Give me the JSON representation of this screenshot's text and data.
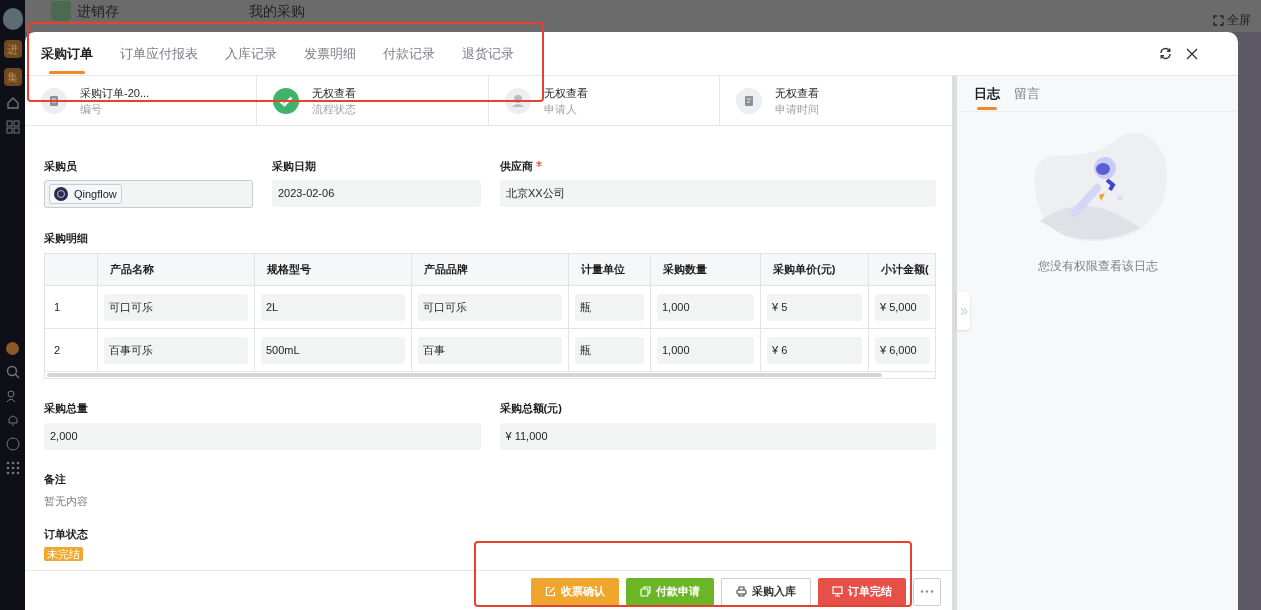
{
  "background": {
    "app_name": "进销存",
    "page_title": "我的采购",
    "fullscreen": "全屏",
    "sidebar_badges": [
      "进",
      "集"
    ]
  },
  "tabs": [
    {
      "label": "采购订单",
      "selected": true
    },
    {
      "label": "订单应付报表",
      "selected": false
    },
    {
      "label": "入库记录",
      "selected": false
    },
    {
      "label": "发票明细",
      "selected": false
    },
    {
      "label": "付款记录",
      "selected": false
    },
    {
      "label": "退货记录",
      "selected": false
    }
  ],
  "info": [
    {
      "kind": "document",
      "value": "采购订单-20...",
      "label": "编号"
    },
    {
      "kind": "done",
      "value": "无权查看",
      "label": "流程状态"
    },
    {
      "kind": "person",
      "value": "无权查看",
      "label": "申请人"
    },
    {
      "kind": "time",
      "value": "无权查看",
      "label": "申请时间"
    }
  ],
  "fields": [
    {
      "kind": "member",
      "label": "采购员",
      "value": "Qingflow",
      "required": false
    },
    {
      "kind": "text",
      "label": "采购日期",
      "value": "2023-02-06",
      "required": false
    },
    {
      "kind": "text",
      "label": "供应商",
      "value": "北京XX公司",
      "required": true
    }
  ],
  "detail": {
    "title": "采购明细",
    "columns": [
      "产品名称",
      "规格型号",
      "产品品牌",
      "计量单位",
      "采购数量",
      "采购单价(元)",
      "小计金额("
    ],
    "rows": [
      {
        "index": "1",
        "cells": [
          "可口可乐",
          "2L",
          "可口可乐",
          "瓶",
          "1,000",
          "¥ 5",
          "¥ 5,000"
        ]
      },
      {
        "index": "2",
        "cells": [
          "百事可乐",
          "500mL",
          "百事",
          "瓶",
          "1,000",
          "¥ 6",
          "¥ 6,000"
        ]
      }
    ]
  },
  "totals": [
    {
      "label": "采购总量",
      "value": "2,000"
    },
    {
      "label": "采购总额(元)",
      "value": "¥ 11,000"
    }
  ],
  "remark": {
    "label": "备注",
    "value": "暂无内容"
  },
  "status": {
    "label": "订单状态",
    "value": "未完结"
  },
  "actions": [
    {
      "kind": "invoice",
      "label": "收票确认"
    },
    {
      "kind": "payment",
      "label": "付款申请"
    },
    {
      "kind": "stock",
      "label": "采购入库"
    },
    {
      "kind": "complete",
      "label": "订单完结"
    }
  ],
  "side_tabs": [
    {
      "label": "日志",
      "selected": true
    },
    {
      "label": "留言",
      "selected": false
    }
  ],
  "side_message": "您没有权限查看该日志"
}
